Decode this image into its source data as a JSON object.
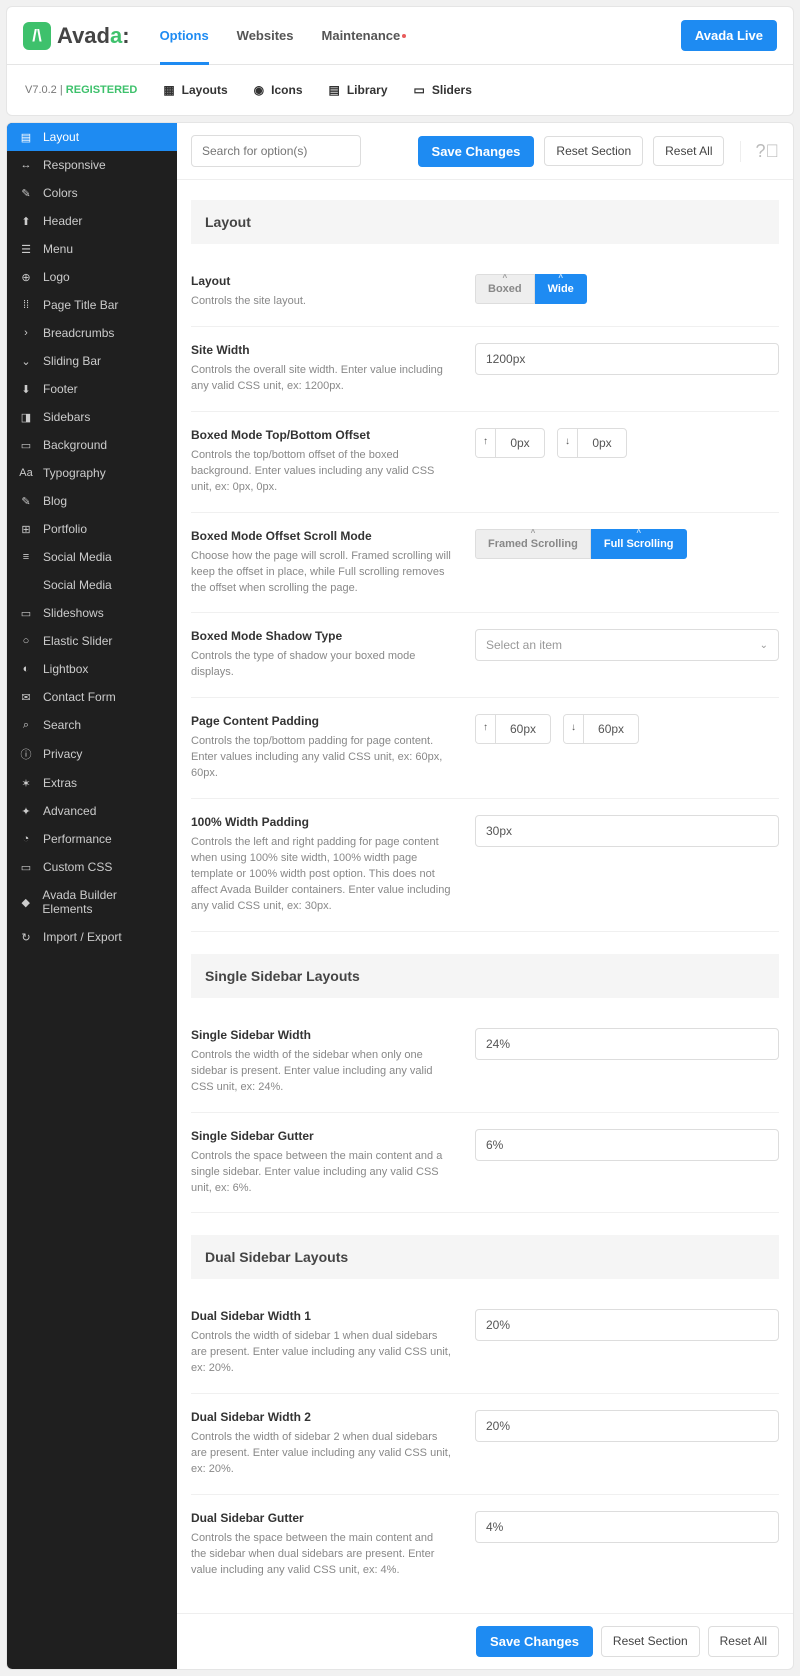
{
  "header": {
    "brand_a": "Avad",
    "brand_b": "a",
    "brand_suffix": ":",
    "tabs": [
      "Options",
      "Websites",
      "Maintenance"
    ],
    "active_tab": 0,
    "live_btn": "Avada Live",
    "version": "V7.0.2",
    "status": "REGISTERED",
    "sub_tabs": [
      {
        "icon": "layouts",
        "label": "Layouts"
      },
      {
        "icon": "icons",
        "label": "Icons"
      },
      {
        "icon": "library",
        "label": "Library"
      },
      {
        "icon": "sliders",
        "label": "Sliders"
      }
    ]
  },
  "sidebar": {
    "items": [
      {
        "label": "Layout",
        "icon": "▤",
        "active": true
      },
      {
        "label": "Responsive",
        "icon": "↔"
      },
      {
        "label": "Colors",
        "icon": "✎"
      },
      {
        "label": "Header",
        "icon": "⬆"
      },
      {
        "label": "Menu",
        "icon": "☰"
      },
      {
        "label": "Logo",
        "icon": "⊕"
      },
      {
        "label": "Page Title Bar",
        "icon": "⁞⁞"
      },
      {
        "label": "Breadcrumbs",
        "icon": "›"
      },
      {
        "label": "Sliding Bar",
        "icon": "⌄"
      },
      {
        "label": "Footer",
        "icon": "⬇"
      },
      {
        "label": "Sidebars",
        "icon": "◨"
      },
      {
        "label": "Background",
        "icon": "▭"
      },
      {
        "label": "Typography",
        "icon": "Aa"
      },
      {
        "label": "Blog",
        "icon": "✎"
      },
      {
        "label": "Portfolio",
        "icon": "⊞"
      },
      {
        "label": "Social Media",
        "icon": "≡"
      },
      {
        "label": "Social Media",
        "icon": ""
      },
      {
        "label": "Slideshows",
        "icon": "▭"
      },
      {
        "label": "Elastic Slider",
        "icon": "○"
      },
      {
        "label": "Lightbox",
        "icon": "◐"
      },
      {
        "label": "Contact Form",
        "icon": "✉"
      },
      {
        "label": "Search",
        "icon": "⌕"
      },
      {
        "label": "Privacy",
        "icon": "ⓘ"
      },
      {
        "label": "Extras",
        "icon": "✶"
      },
      {
        "label": "Advanced",
        "icon": "✦"
      },
      {
        "label": "Performance",
        "icon": "◔"
      },
      {
        "label": "Custom CSS",
        "icon": "▭"
      },
      {
        "label": "Avada Builder Elements",
        "icon": "◆"
      },
      {
        "label": "Import / Export",
        "icon": "↻"
      }
    ]
  },
  "toolbar": {
    "search_placeholder": "Search for option(s)",
    "save": "Save Changes",
    "reset_section": "Reset Section",
    "reset_all": "Reset All"
  },
  "sections": [
    {
      "title": "Layout",
      "rows": [
        {
          "k": "layout",
          "title": "Layout",
          "desc": "Controls the site layout.",
          "type": "toggle",
          "options": [
            "Boxed",
            "Wide"
          ],
          "sel": 1
        },
        {
          "k": "site_width",
          "title": "Site Width",
          "desc": "Controls the overall site width. Enter value including any valid CSS unit, ex: 1200px.",
          "type": "text",
          "value": "1200px"
        },
        {
          "k": "boxed_offset",
          "title": "Boxed Mode Top/Bottom Offset",
          "desc": "Controls the top/bottom offset of the boxed background. Enter values including any valid CSS unit, ex: 0px, 0px.",
          "type": "dual",
          "v1": "0px",
          "v2": "0px"
        },
        {
          "k": "scroll_mode",
          "title": "Boxed Mode Offset Scroll Mode",
          "desc": "Choose how the page will scroll. Framed scrolling will keep the offset in place, while Full scrolling removes the offset when scrolling the page.",
          "type": "toggle",
          "options": [
            "Framed Scrolling",
            "Full Scrolling"
          ],
          "sel": 1
        },
        {
          "k": "shadow",
          "title": "Boxed Mode Shadow Type",
          "desc": "Controls the type of shadow your boxed mode displays.",
          "type": "select",
          "placeholder": "Select an item"
        },
        {
          "k": "content_pad",
          "title": "Page Content Padding",
          "desc": "Controls the top/bottom padding for page content. Enter values including any valid CSS unit, ex: 60px, 60px.",
          "type": "dual",
          "v1": "60px",
          "v2": "60px"
        },
        {
          "k": "full_pad",
          "title": "100% Width Padding",
          "desc": "Controls the left and right padding for page content when using 100% site width, 100% width page template or 100% width post option. This does not affect Avada Builder containers. Enter value including any valid CSS unit, ex: 30px.",
          "type": "text",
          "value": "30px"
        }
      ]
    },
    {
      "title": "Single Sidebar Layouts",
      "rows": [
        {
          "k": "ssw",
          "title": "Single Sidebar Width",
          "desc": "Controls the width of the sidebar when only one sidebar is present. Enter value including any valid CSS unit, ex: 24%.",
          "type": "text",
          "value": "24%"
        },
        {
          "k": "ssg",
          "title": "Single Sidebar Gutter",
          "desc": "Controls the space between the main content and a single sidebar. Enter value including any valid CSS unit, ex: 6%.",
          "type": "text",
          "value": "6%"
        }
      ]
    },
    {
      "title": "Dual Sidebar Layouts",
      "rows": [
        {
          "k": "dsw1",
          "title": "Dual Sidebar Width 1",
          "desc": "Controls the width of sidebar 1 when dual sidebars are present. Enter value including any valid CSS unit, ex: 20%.",
          "type": "text",
          "value": "20%"
        },
        {
          "k": "dsw2",
          "title": "Dual Sidebar Width 2",
          "desc": "Controls the width of sidebar 2 when dual sidebars are present. Enter value including any valid CSS unit, ex: 20%.",
          "type": "text",
          "value": "20%"
        },
        {
          "k": "dsg",
          "title": "Dual Sidebar Gutter",
          "desc": "Controls the space between the main content and the sidebar when dual sidebars are present. Enter value including any valid CSS unit, ex: 4%.",
          "type": "text",
          "value": "4%"
        }
      ]
    }
  ],
  "footer": {
    "save": "Save Changes",
    "reset_section": "Reset Section",
    "reset_all": "Reset All"
  }
}
